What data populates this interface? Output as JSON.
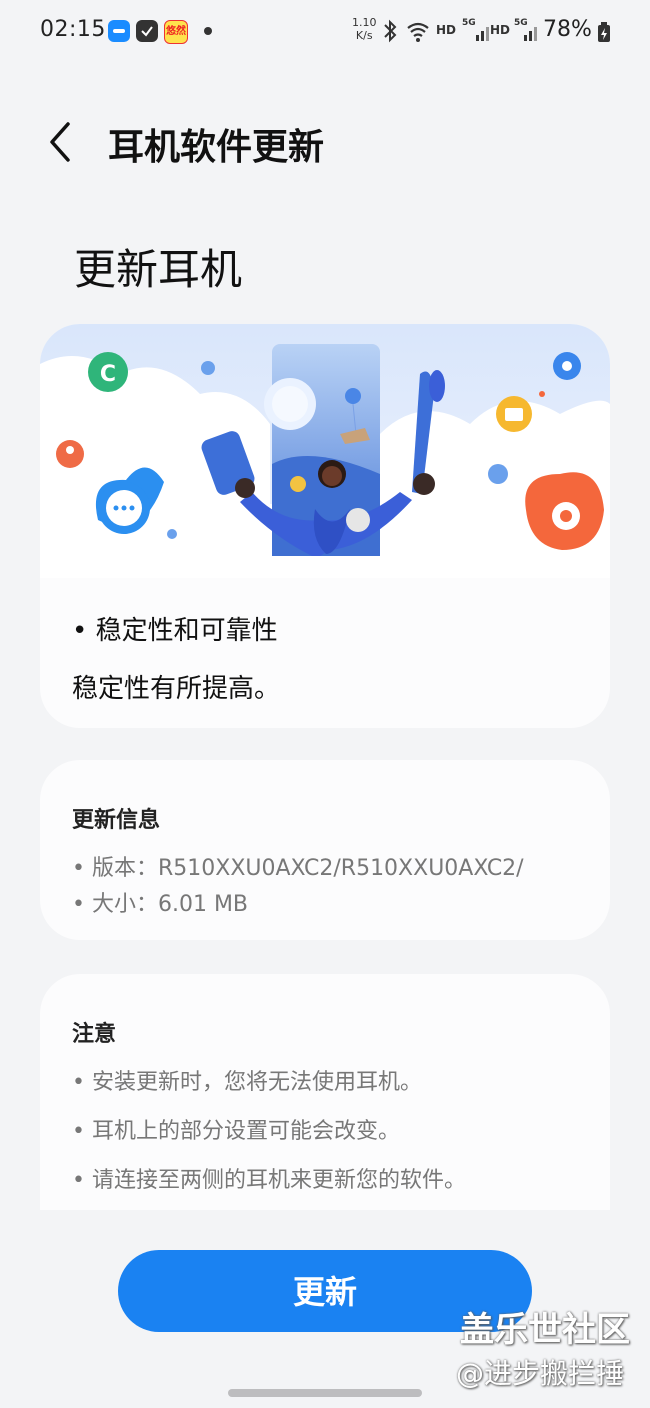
{
  "status_bar": {
    "time": "02:15",
    "net_speed_value": "1.10",
    "net_speed_unit": "K/s",
    "hd_label_1": "HD",
    "hd_label_2": "HD",
    "sig_label_1": "5G",
    "sig_label_2": "5G",
    "battery": "78%",
    "app_badge_text": "悠然"
  },
  "header": {
    "title": "耳机软件更新",
    "back_icon": "chevron-left-icon"
  },
  "headline": "更新耳机",
  "whats_new": {
    "item_title": "• 稳定性和可靠性",
    "item_description": "稳定性有所提高。"
  },
  "update_info": {
    "title": "更新信息",
    "version_line": "• 版本：R510XXU0AXC2/R510XXU0AXC2/",
    "size_line": "• 大小：6.01 MB"
  },
  "notes": {
    "title": "注意",
    "items": [
      "• 安装更新时，您将无法使用耳机。",
      "• 耳机上的部分设置可能会改变。",
      "• 请连接至两侧的耳机来更新您的软件。"
    ]
  },
  "update_button": "更新",
  "watermark": {
    "line1": "盖乐世社区",
    "line2": "@进步搬拦捶"
  },
  "colors": {
    "accent": "#1a82f2",
    "background": "#f3f4f6",
    "card": "#fcfcfd"
  }
}
